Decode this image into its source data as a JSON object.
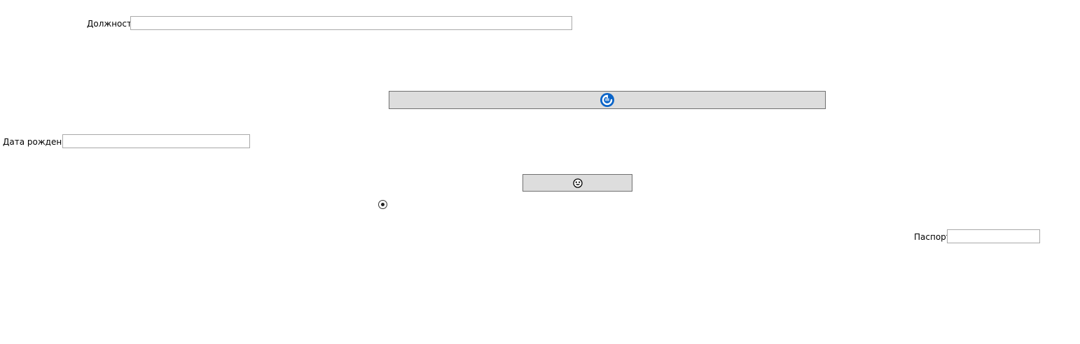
{
  "form": {
    "position_label": "Должность",
    "position_value": "",
    "birthdate_label": "Дата рождения",
    "birthdate_value": "",
    "passport_label": "Паспорт",
    "passport_value": ""
  },
  "buttons": {
    "refresh": {
      "icon": "refresh-icon",
      "color": "#0a64c8"
    },
    "face": {
      "icon": "face-icon"
    }
  },
  "radio": {
    "checked": true
  },
  "colors": {
    "button_bg": "#dddddd",
    "button_border": "#707070",
    "field_border": "#a9a9a9",
    "accent": "#0a64c8"
  }
}
